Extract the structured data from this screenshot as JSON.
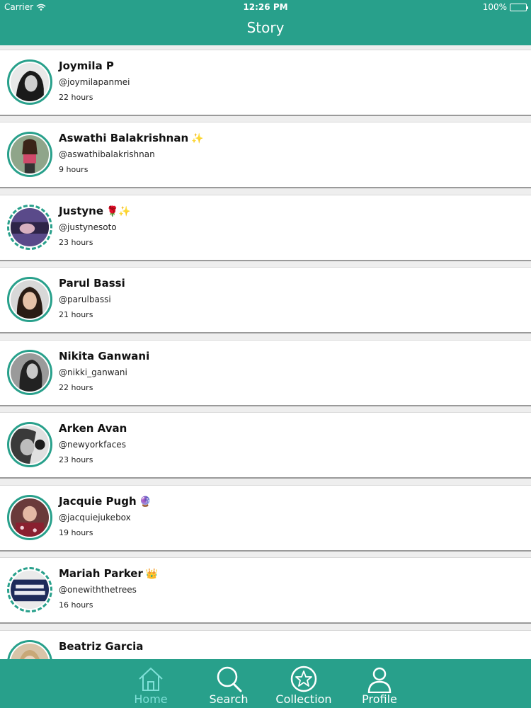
{
  "status_bar": {
    "carrier": "Carrier",
    "time": "12:26 PM",
    "battery": "100%"
  },
  "nav": {
    "title": "Story"
  },
  "stories": [
    {
      "name": "Joymila P",
      "emoji": "",
      "handle": "@joymilapanmei",
      "time": "22 hours"
    },
    {
      "name": "Aswathi Balakrishnan",
      "emoji": "✨",
      "handle": "@aswathibalakrishnan",
      "time": "9 hours"
    },
    {
      "name": "Justyne",
      "emoji": "🌹✨",
      "handle": "@justynesoto",
      "time": "23 hours"
    },
    {
      "name": "Parul Bassi",
      "emoji": "",
      "handle": "@parulbassi",
      "time": "21 hours"
    },
    {
      "name": "Nikita Ganwani",
      "emoji": "",
      "handle": "@nikki_ganwani",
      "time": "22 hours"
    },
    {
      "name": "Arken Avan",
      "emoji": "",
      "handle": "@newyorkfaces",
      "time": "23 hours"
    },
    {
      "name": "Jacquie Pugh",
      "emoji": "🔮",
      "handle": "@jacquiejukebox",
      "time": "19 hours"
    },
    {
      "name": "Mariah Parker",
      "emoji": "👑",
      "handle": "@onewiththetrees",
      "time": "16 hours"
    },
    {
      "name": "Beatriz Garcia",
      "emoji": "",
      "handle": "",
      "time": ""
    }
  ],
  "tabs": [
    {
      "label": "Home",
      "icon": "home-icon",
      "active": true
    },
    {
      "label": "Search",
      "icon": "search-icon",
      "active": false
    },
    {
      "label": "Collection",
      "icon": "star-icon",
      "active": false
    },
    {
      "label": "Profile",
      "icon": "profile-icon",
      "active": false
    }
  ],
  "colors": {
    "accent": "#28a08b",
    "active_tab": "#7fe0d8"
  }
}
